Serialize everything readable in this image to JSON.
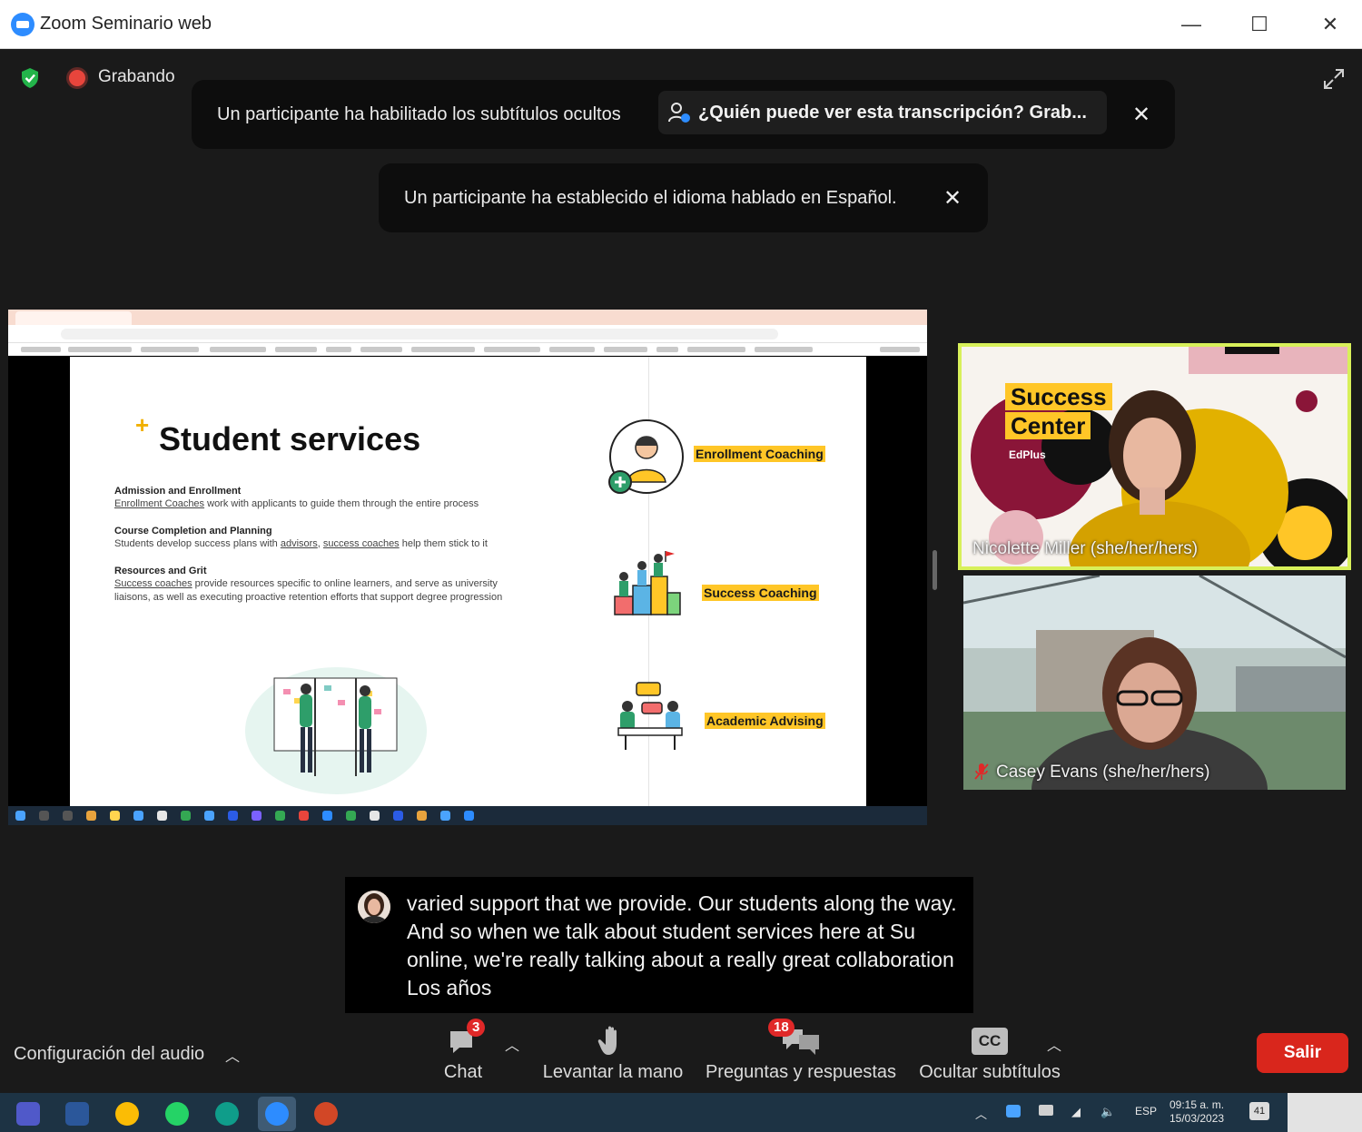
{
  "window": {
    "title": "Zoom Seminario web",
    "minimize": "—",
    "maximize": "☐",
    "close": "✕"
  },
  "status": {
    "recording": "Grabando"
  },
  "notifications": {
    "cc_enabled": "Un participante ha habilitado los subtítulos ocultos",
    "who_can_see": "¿Quién puede ver esta transcripción? Grab...",
    "language_set": "Un participante ha establecido el idioma hablado en Español."
  },
  "slide": {
    "title": "Student services",
    "items": [
      {
        "heading": "Admission and Enrollment",
        "link": "Enrollment Coaches",
        "text": " work with applicants to guide them through the entire process"
      },
      {
        "heading": "Course Completion and Planning",
        "pre": "Students develop success plans with ",
        "link1": "advisors",
        "sep": ", ",
        "link2": "success coaches",
        "post": " help them stick to it"
      },
      {
        "heading": "Resources and Grit",
        "link": "Success coaches",
        "text": " provide resources specific to online learners, and serve as university liaisons, as well as executing proactive retention efforts that support degree progression"
      }
    ],
    "services": [
      "Enrollment Coaching",
      "Success Coaching",
      "Academic Advising"
    ]
  },
  "participants": [
    {
      "name": "Nicolette Miller (she/her/hers)",
      "bg_word1": "Success",
      "bg_word2": "Center",
      "bg_brand": "EdPlus"
    },
    {
      "name": "Casey Evans (she/her/hers)"
    }
  ],
  "captions": {
    "text": "varied support that we provide. Our students along the way. And so when we talk about student services here at Su online, we're really talking about a really great collaboration Los años"
  },
  "toolbar": {
    "audio": "Configuración del audio",
    "chat": "Chat",
    "chat_badge": "3",
    "raise_hand": "Levantar la mano",
    "qa": "Preguntas y respuestas",
    "qa_badge": "18",
    "cc_icon": "CC",
    "cc": "Ocultar subtítulos",
    "leave": "Salir"
  },
  "os_taskbar": {
    "lang": "ESP",
    "time": "09:15 a. m.",
    "date": "15/03/2023",
    "notif_count": "41"
  },
  "colors": {
    "accent_yellow": "#ffc627",
    "leave_red": "#d9261c",
    "active_speaker": "#d8f05a",
    "zoom_blue": "#2d8cff"
  }
}
